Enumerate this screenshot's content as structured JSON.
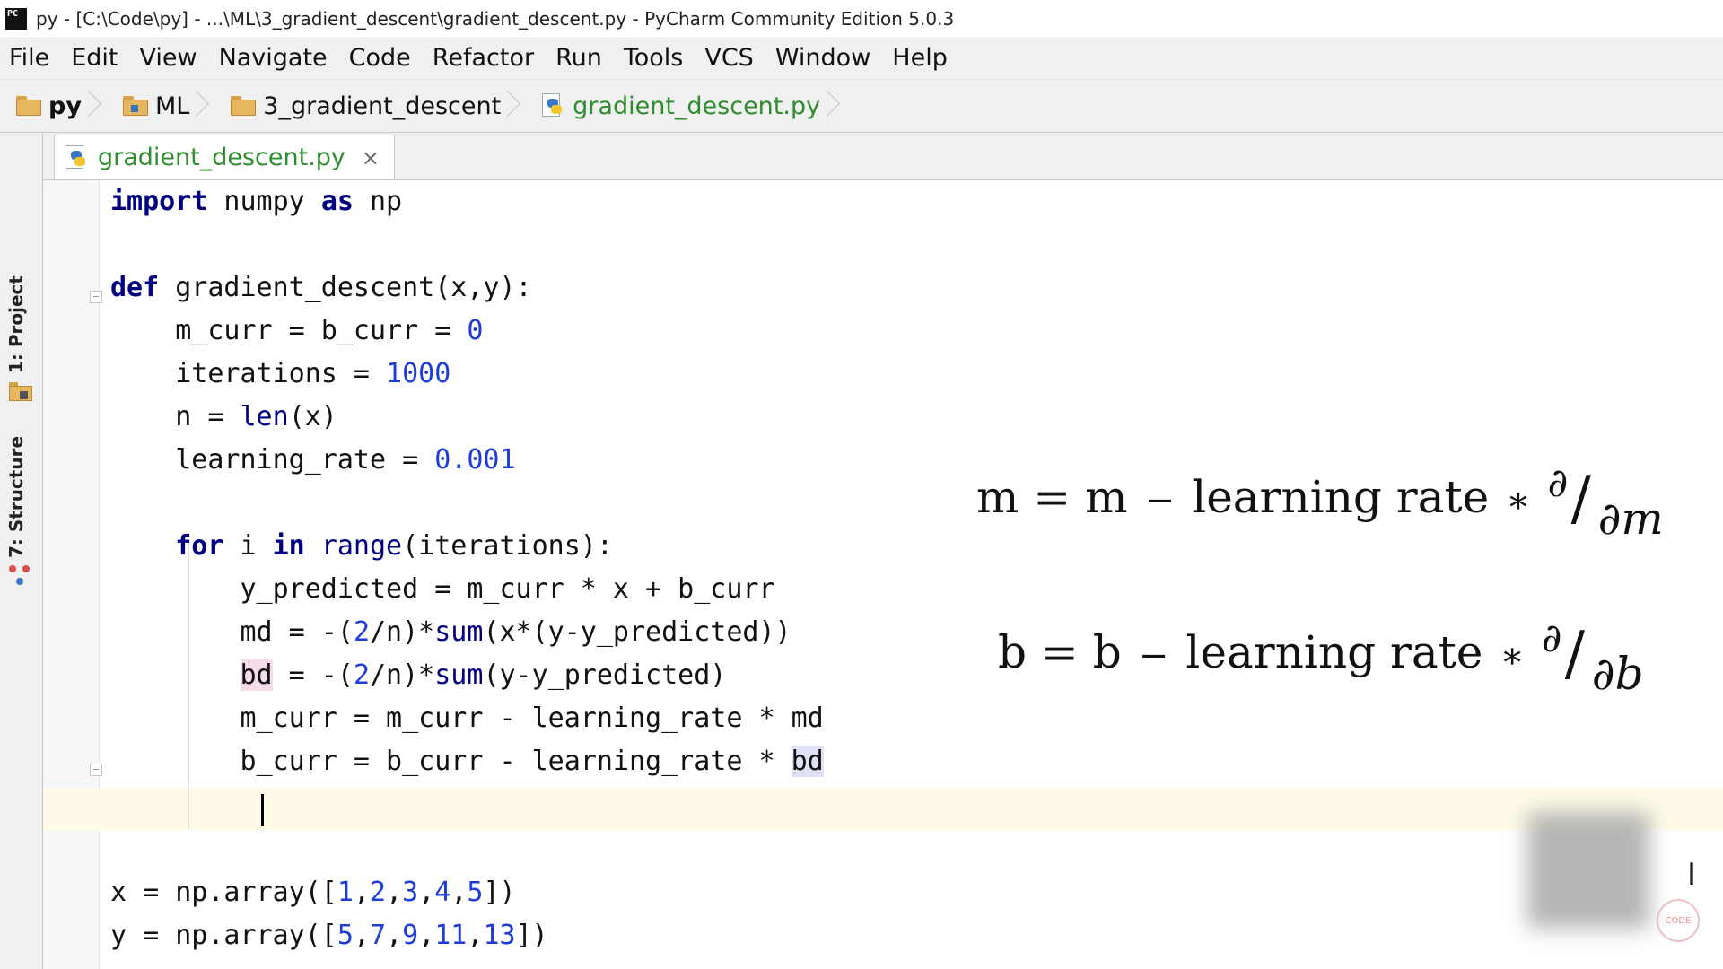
{
  "window": {
    "app_icon_text": "PC",
    "title": "py - [C:\\Code\\py] - ...\\ML\\3_gradient_descent\\gradient_descent.py - PyCharm Community Edition 5.0.3"
  },
  "menu": [
    "File",
    "Edit",
    "View",
    "Navigate",
    "Code",
    "Refactor",
    "Run",
    "Tools",
    "VCS",
    "Window",
    "Help"
  ],
  "breadcrumb": [
    "py",
    "ML",
    "3_gradient_descent",
    "gradient_descent.py"
  ],
  "toolstrip": {
    "project": "1: Project",
    "structure": "7: Structure"
  },
  "editor_tab": {
    "label": "gradient_descent.py",
    "close": "×"
  },
  "code": {
    "l1": [
      "import",
      " numpy ",
      "as",
      " np"
    ],
    "l3": [
      "def",
      " gradient_descent(x,y):"
    ],
    "l4": [
      "    m_curr = b_curr = ",
      "0"
    ],
    "l5": [
      "    iterations = ",
      "1000"
    ],
    "l6": [
      "    n = ",
      "len",
      "(x)"
    ],
    "l7": [
      "    learning_rate = ",
      "0.001"
    ],
    "l9": [
      "    ",
      "for",
      " i ",
      "in",
      " ",
      "range",
      "(iterations):"
    ],
    "l10": "        y_predicted = m_curr * x + b_curr",
    "l11": [
      "        md = -(",
      "2",
      "/n)*",
      "sum",
      "(x*(y-y_predicted))"
    ],
    "l12": [
      "        ",
      "bd",
      " = -(",
      "2",
      "/n)*",
      "sum",
      "(y-y_predicted)"
    ],
    "l13": "        m_curr = m_curr - learning_rate * md",
    "l14": [
      "        b_curr = b_curr - learning_rate * ",
      "bd"
    ],
    "l17": [
      "x = np.array([",
      "1",
      ",",
      "2",
      ",",
      "3",
      ",",
      "4",
      ",",
      "5",
      "])"
    ],
    "l18": [
      "y = np.array([",
      "5",
      ",",
      "7",
      ",",
      "9",
      ",",
      "11",
      ",",
      "13",
      "])"
    ]
  },
  "formulas": {
    "m": {
      "lhs": "m = m",
      "minus": "−",
      "rhs": "learning rate",
      "times": "∗",
      "partial": "∂",
      "slash": "/",
      "den": "∂m"
    },
    "b": {
      "lhs": "b = b",
      "minus": "−",
      "rhs": "learning rate",
      "times": "∗",
      "partial": "∂",
      "slash": "/",
      "den": "∂b"
    }
  },
  "overlay": {
    "text_cursor": "I",
    "watermark": "CODE"
  }
}
